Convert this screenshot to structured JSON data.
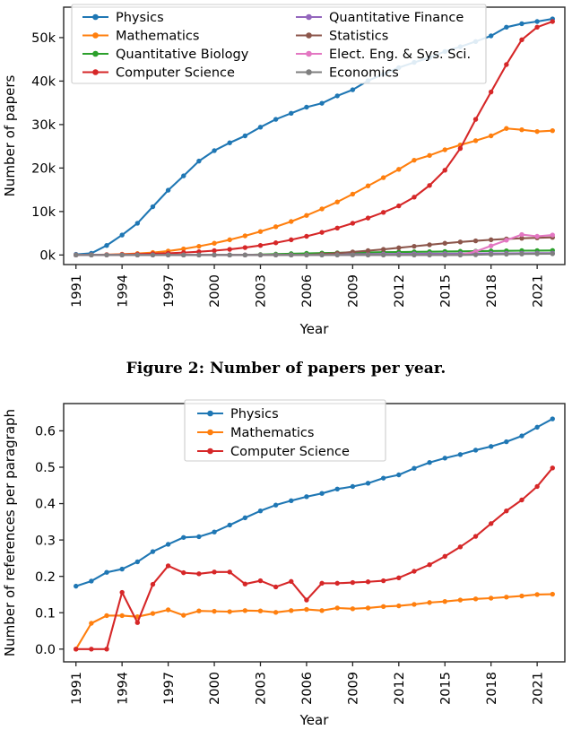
{
  "figure": {
    "caption": "Figure 2: Number of papers per year."
  },
  "chart_data": [
    {
      "id": "papers-per-year",
      "type": "line",
      "title": "",
      "xlabel": "Year",
      "ylabel": "Number of papers",
      "x": [
        1991,
        1992,
        1993,
        1994,
        1995,
        1996,
        1997,
        1998,
        1999,
        2000,
        2001,
        2002,
        2003,
        2004,
        2005,
        2006,
        2007,
        2008,
        2009,
        2010,
        2011,
        2012,
        2013,
        2014,
        2015,
        2016,
        2017,
        2018,
        2019,
        2020,
        2021,
        2022
      ],
      "xlim": [
        1990.2,
        2022.8
      ],
      "ylim": [
        -2200,
        57000
      ],
      "xticks": [
        1991,
        1994,
        1997,
        2000,
        2003,
        2006,
        2009,
        2012,
        2015,
        2018,
        2021
      ],
      "xticklabels": [
        "1991",
        "1994",
        "1997",
        "2000",
        "2003",
        "2006",
        "2009",
        "2012",
        "2015",
        "2018",
        "2021"
      ],
      "yticks": [
        0,
        10000,
        20000,
        30000,
        40000,
        50000
      ],
      "yticklabels": [
        "0k",
        "10k",
        "20k",
        "30k",
        "40k",
        "50k"
      ],
      "grid": false,
      "legend_position": "upper-left-wide",
      "legend_columns": 2,
      "series": [
        {
          "name": "Physics",
          "color": "#1f77b4",
          "values": [
            150,
            400,
            2200,
            4600,
            7300,
            11100,
            14900,
            18200,
            21600,
            24000,
            25800,
            27400,
            29400,
            31200,
            32600,
            34000,
            34900,
            36600,
            38000,
            40100,
            41600,
            43100,
            44300,
            45400,
            46800,
            47900,
            49100,
            50400,
            52400,
            53200,
            53700,
            54300
          ]
        },
        {
          "name": "Mathematics",
          "color": "#ff7f0e",
          "values": [
            10,
            30,
            80,
            180,
            330,
            560,
            900,
            1400,
            2000,
            2700,
            3500,
            4400,
            5400,
            6500,
            7700,
            9100,
            10600,
            12200,
            14000,
            15900,
            17800,
            19700,
            21800,
            22900,
            24200,
            25300,
            26300,
            27400,
            29100,
            28800,
            28400,
            28600
          ]
        },
        {
          "name": "Quantitative Biology",
          "color": "#2ca02c",
          "values": [
            0,
            0,
            0,
            0,
            0,
            0,
            0,
            0,
            0,
            0,
            0,
            0,
            100,
            200,
            300,
            380,
            440,
            500,
            550,
            600,
            640,
            680,
            720,
            760,
            800,
            840,
            880,
            920,
            960,
            1000,
            1020,
            1040
          ]
        },
        {
          "name": "Computer Science",
          "color": "#d62728",
          "values": [
            20,
            40,
            70,
            120,
            190,
            280,
            400,
            560,
            760,
            1000,
            1300,
            1700,
            2200,
            2800,
            3500,
            4300,
            5200,
            6200,
            7300,
            8500,
            9800,
            11300,
            13300,
            16000,
            19500,
            24500,
            31200,
            37500,
            43800,
            49500,
            52400,
            53700
          ]
        },
        {
          "name": "Quantitative Finance",
          "color": "#9467bd",
          "values": [
            0,
            0,
            0,
            0,
            0,
            0,
            0,
            0,
            0,
            0,
            0,
            0,
            0,
            0,
            0,
            0,
            60,
            110,
            150,
            180,
            210,
            240,
            260,
            280,
            300,
            320,
            340,
            360,
            380,
            400,
            410,
            420
          ]
        },
        {
          "name": "Statistics",
          "color": "#8c564b",
          "values": [
            0,
            0,
            0,
            0,
            0,
            0,
            0,
            0,
            0,
            0,
            0,
            0,
            0,
            0,
            0,
            0,
            200,
            420,
            700,
            1000,
            1300,
            1650,
            2000,
            2350,
            2700,
            3000,
            3250,
            3500,
            3700,
            3850,
            3950,
            4050
          ]
        },
        {
          "name": "Elect. Eng. & Sys. Sci.",
          "color": "#e377c2",
          "values": [
            0,
            0,
            0,
            0,
            0,
            0,
            0,
            0,
            0,
            0,
            0,
            0,
            0,
            0,
            0,
            0,
            0,
            0,
            0,
            0,
            0,
            0,
            0,
            0,
            0,
            0,
            800,
            2100,
            3400,
            4700,
            4300,
            4600
          ]
        },
        {
          "name": "Economics",
          "color": "#7f7f7f",
          "values": [
            0,
            0,
            0,
            0,
            0,
            0,
            0,
            0,
            0,
            0,
            0,
            0,
            0,
            0,
            0,
            0,
            0,
            0,
            0,
            0,
            0,
            0,
            0,
            0,
            0,
            0,
            60,
            120,
            180,
            230,
            260,
            280
          ]
        }
      ]
    },
    {
      "id": "references-per-paragraph",
      "type": "line",
      "title": "",
      "xlabel": "Year",
      "ylabel": "Number of references per paragraph",
      "x": [
        1991,
        1992,
        1993,
        1994,
        1995,
        1996,
        1997,
        1998,
        1999,
        2000,
        2001,
        2002,
        2003,
        2004,
        2005,
        2006,
        2007,
        2008,
        2009,
        2010,
        2011,
        2012,
        2013,
        2014,
        2015,
        2016,
        2017,
        2018,
        2019,
        2020,
        2021,
        2022
      ],
      "xlim": [
        1990.2,
        2022.8
      ],
      "ylim": [
        -0.035,
        0.675
      ],
      "xticks": [
        1991,
        1994,
        1997,
        2000,
        2003,
        2006,
        2009,
        2012,
        2015,
        2018,
        2021
      ],
      "xticklabels": [
        "1991",
        "1994",
        "1997",
        "2000",
        "2003",
        "2006",
        "2009",
        "2012",
        "2015",
        "2018",
        "2021"
      ],
      "yticks": [
        0.0,
        0.1,
        0.2,
        0.3,
        0.4,
        0.5,
        0.6
      ],
      "yticklabels": [
        "0.0",
        "0.1",
        "0.2",
        "0.3",
        "0.4",
        "0.5",
        "0.6"
      ],
      "grid": false,
      "legend_position": "upper-center",
      "legend_columns": 1,
      "series": [
        {
          "name": "Physics",
          "color": "#1f77b4",
          "values": [
            0.173,
            0.187,
            0.211,
            0.22,
            0.24,
            0.268,
            0.288,
            0.307,
            0.309,
            0.322,
            0.341,
            0.361,
            0.38,
            0.396,
            0.408,
            0.419,
            0.428,
            0.44,
            0.447,
            0.456,
            0.47,
            0.479,
            0.497,
            0.513,
            0.525,
            0.535,
            0.547,
            0.557,
            0.57,
            0.586,
            0.61,
            0.633
          ]
        },
        {
          "name": "Mathematics",
          "color": "#ff7f0e",
          "values": [
            0.0,
            0.071,
            0.092,
            0.092,
            0.089,
            0.098,
            0.108,
            0.093,
            0.105,
            0.104,
            0.103,
            0.106,
            0.105,
            0.101,
            0.106,
            0.109,
            0.106,
            0.113,
            0.111,
            0.113,
            0.117,
            0.119,
            0.123,
            0.128,
            0.131,
            0.135,
            0.138,
            0.14,
            0.143,
            0.146,
            0.15,
            0.151
          ]
        },
        {
          "name": "Computer Science",
          "color": "#d62728",
          "values": [
            0.0,
            0.0,
            0.0,
            0.156,
            0.073,
            0.178,
            0.229,
            0.21,
            0.207,
            0.212,
            0.212,
            0.179,
            0.188,
            0.171,
            0.186,
            0.135,
            0.181,
            0.181,
            0.183,
            0.185,
            0.188,
            0.196,
            0.214,
            0.232,
            0.255,
            0.281,
            0.31,
            0.345,
            0.38,
            0.41,
            0.447,
            0.498
          ]
        }
      ]
    }
  ]
}
